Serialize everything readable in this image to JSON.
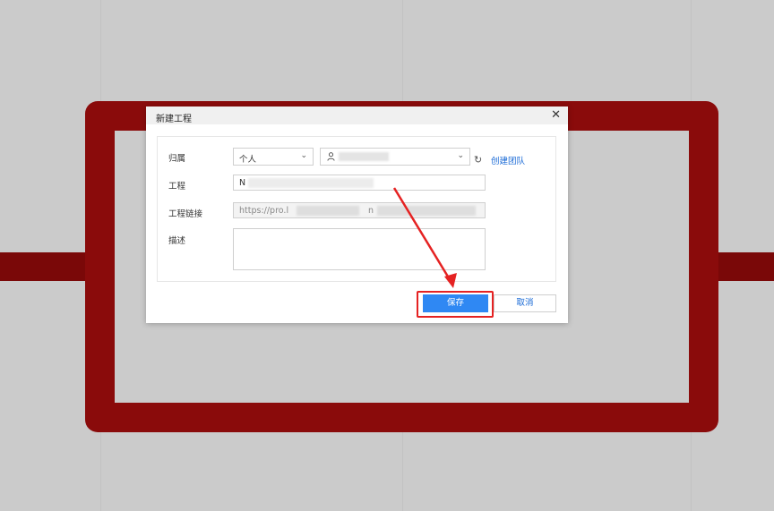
{
  "dialog": {
    "title": "新建工程",
    "close_glyph": "✕",
    "fields": {
      "owner_label": "归属",
      "owner_type_value": "个人",
      "project_label": "工程",
      "project_value": "N",
      "link_label": "工程链接",
      "link_value": "https://pro.l",
      "link_tail_1": "n",
      "desc_label": "描述"
    },
    "create_team_label": "创建团队",
    "save_label": "保存",
    "cancel_label": "取消"
  },
  "icons": {
    "close": "close-icon",
    "chevron": "chevron-down-icon",
    "user": "user-icon",
    "refresh": "refresh-icon"
  },
  "colors": {
    "frame": "#8a0b0b",
    "primary": "#2f88f3",
    "annotation": "#e52222",
    "link": "#1a6ad6"
  }
}
